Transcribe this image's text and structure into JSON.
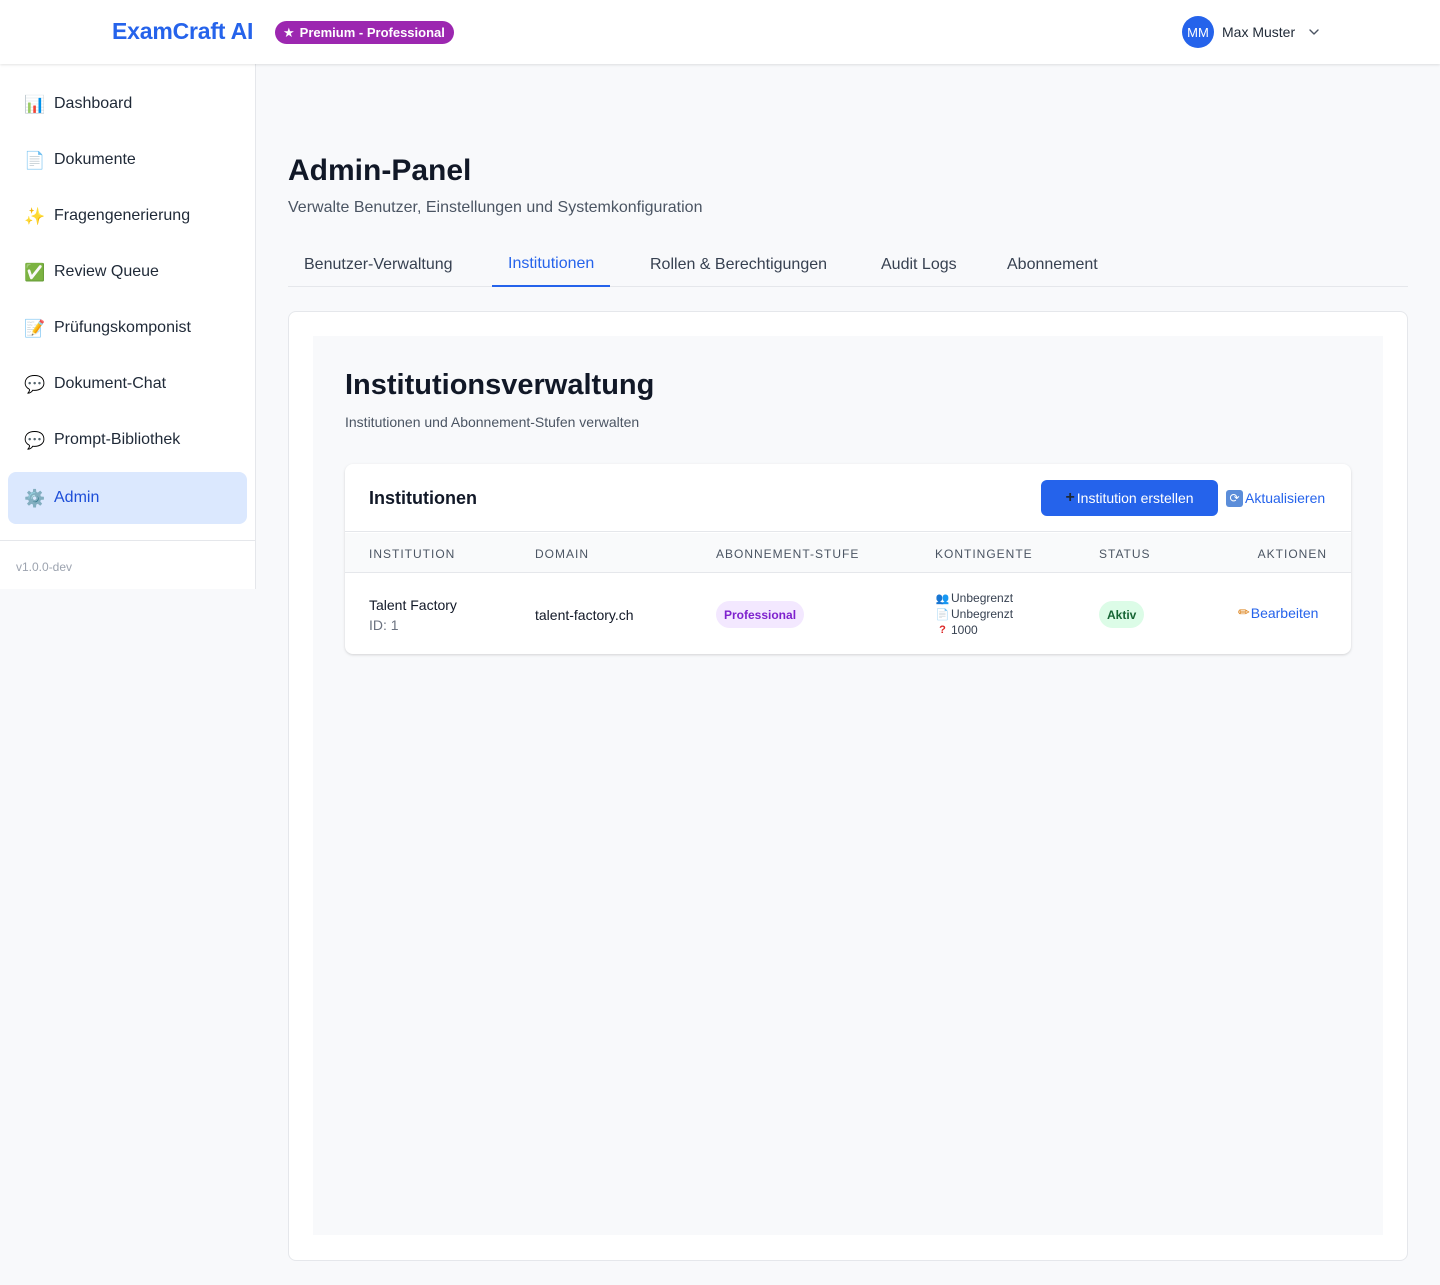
{
  "header": {
    "brand": "ExamCraft AI",
    "plan_badge": "Premium - Professional",
    "user_initials": "MM",
    "user_name": "Max Muster"
  },
  "sidebar": {
    "items": [
      {
        "label": "Dashboard",
        "icon": "📊",
        "icon_name": "bar-chart-icon"
      },
      {
        "label": "Dokumente",
        "icon": "📄",
        "icon_name": "document-icon"
      },
      {
        "label": "Fragengenerierung",
        "icon": "✨",
        "icon_name": "sparkles-icon"
      },
      {
        "label": "Review Queue",
        "icon": "✅",
        "icon_name": "check-icon"
      },
      {
        "label": "Prüfungskomponist",
        "icon": "📝",
        "icon_name": "memo-icon"
      },
      {
        "label": "Dokument-Chat",
        "icon": "💬",
        "icon_name": "chat-icon"
      },
      {
        "label": "Prompt-Bibliothek",
        "icon": "💬",
        "icon_name": "chat-icon"
      },
      {
        "label": "Admin",
        "icon": "⚙️",
        "icon_name": "gear-icon",
        "active": true
      }
    ],
    "version": "v1.0.0-dev"
  },
  "page": {
    "title": "Admin-Panel",
    "subtitle": "Verwalte Benutzer, Einstellungen und Systemkonfiguration",
    "tabs": [
      {
        "label": "Benutzer-Verwaltung"
      },
      {
        "label": "Institutionen",
        "active": true
      },
      {
        "label": "Rollen & Berechtigungen"
      },
      {
        "label": "Audit Logs"
      },
      {
        "label": "Abonnement"
      }
    ]
  },
  "section": {
    "title": "Institutionsverwaltung",
    "subtitle": "Institutionen und Abonnement-Stufen verwalten",
    "card_title": "Institutionen",
    "create_button": "Institution erstellen",
    "refresh_button": "Aktualisieren",
    "columns": [
      "Institution",
      "Domain",
      "Abonnement-Stufe",
      "Kontingente",
      "Status",
      "Aktionen"
    ],
    "rows": [
      {
        "name": "Talent Factory",
        "id_label": "ID: 1",
        "domain": "talent-factory.ch",
        "tier": "Professional",
        "quotas": [
          {
            "icon": "👥",
            "icon_name": "users-icon",
            "value": "Unbegrenzt"
          },
          {
            "icon": "📄",
            "icon_name": "document-icon",
            "value": "Unbegrenzt"
          },
          {
            "icon": "?",
            "icon_name": "question-icon",
            "value": "1000"
          }
        ],
        "status": "Aktiv",
        "action": "Bearbeiten"
      }
    ]
  },
  "colors": {
    "primary": "#2563eb",
    "premium_badge": "#9c27b0",
    "active_nav_bg": "#dbe8fe",
    "tier_badge_bg": "#f3e8ff",
    "status_badge_bg": "#dcfce7"
  }
}
